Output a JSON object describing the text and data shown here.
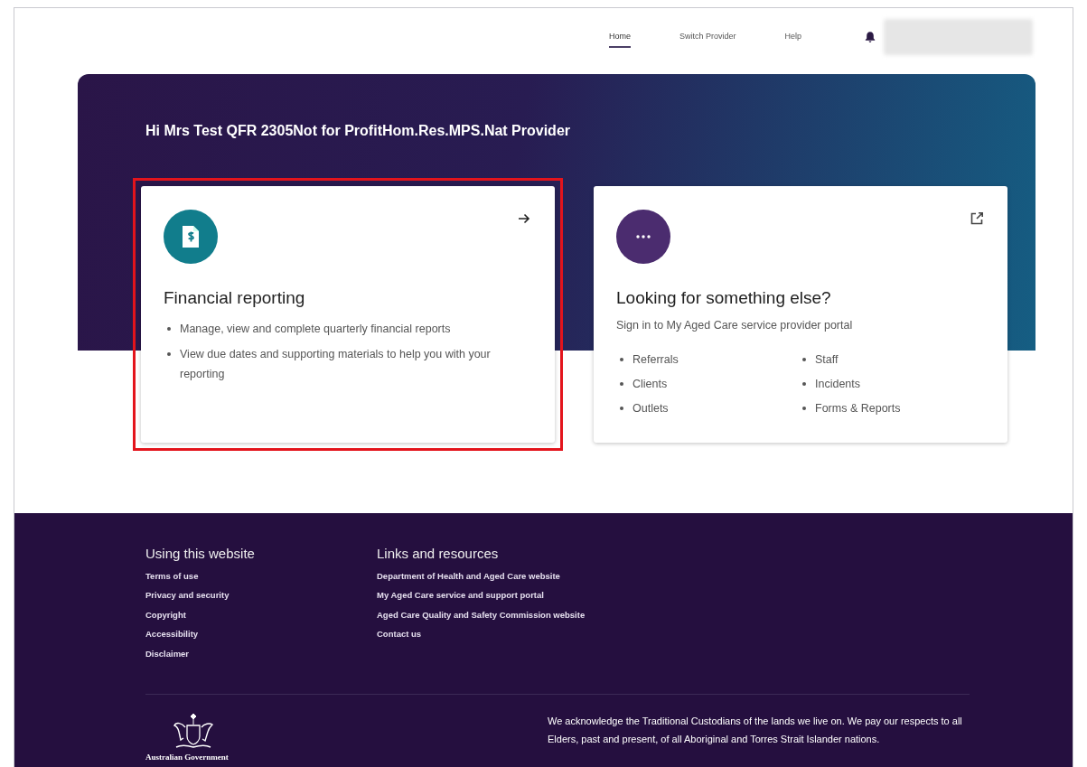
{
  "nav": {
    "links": [
      {
        "label": "Home",
        "selected": true
      },
      {
        "label": "Switch Provider",
        "selected": false
      },
      {
        "label": "Help",
        "selected": false
      }
    ]
  },
  "greeting": "Hi Mrs Test QFR 2305Not for ProfitHom.Res.MPS.Nat Provider",
  "cards": [
    {
      "kind": "financial",
      "highlighted": true,
      "title": "Financial reporting",
      "bullets": [
        "Manage, view and complete quarterly financial reports",
        "View due dates and supporting materials to help you with your reporting"
      ]
    },
    {
      "kind": "external",
      "highlighted": false,
      "title": "Looking for something else?",
      "subtitle": "Sign in to My Aged Care service provider portal",
      "bullets": [
        "Referrals",
        "Clients",
        "Outlets",
        "Staff",
        "Incidents",
        "Forms & Reports"
      ]
    }
  ],
  "footer": {
    "columns": [
      {
        "heading": "Using this website",
        "links": [
          "Terms of use",
          "Privacy and security",
          "Copyright",
          "Accessibility",
          "Disclaimer"
        ]
      },
      {
        "heading": "Links and resources",
        "links": [
          "Department of Health and Aged Care website",
          "My Aged Care service and support portal",
          "Aged Care Quality and Safety Commission website",
          "Contact us"
        ]
      }
    ],
    "logo_text": "Australian Government",
    "acknowledgement": "We acknowledge the Traditional Custodians of the lands we live on. We pay our respects to all Elders, past and present, of all Aboriginal and Torres Strait Islander nations."
  }
}
